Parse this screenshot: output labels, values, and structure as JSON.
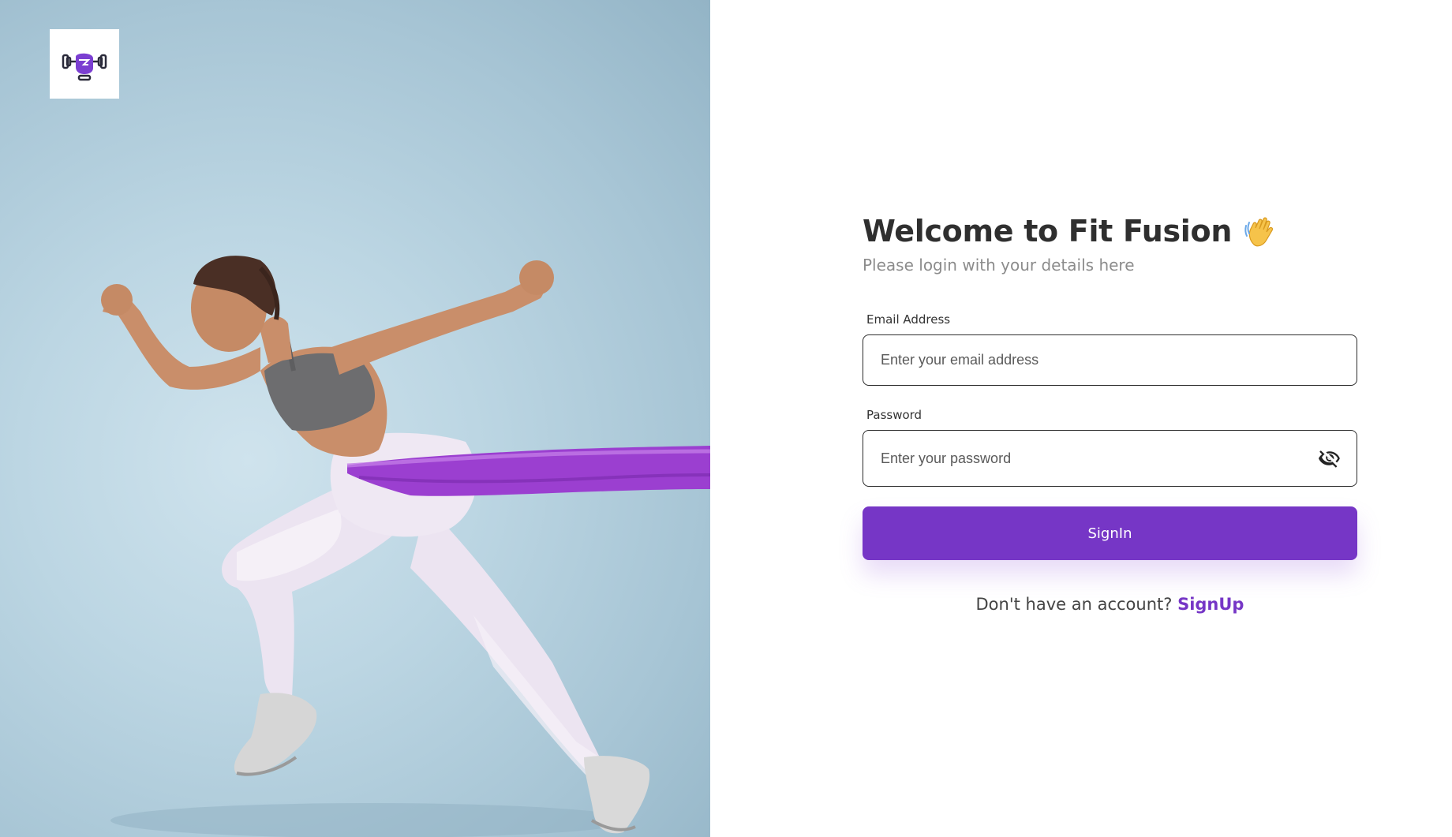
{
  "app": {
    "name": "Fit Fusion"
  },
  "hero": {
    "logo_icon": "dumbbell-boxing-glove-icon",
    "image_subject": "athlete-running-with-resistance-band",
    "band_color": "#9b3fd0"
  },
  "login": {
    "title": "Welcome to Fit Fusion",
    "title_emoji_icon": "waving-hand-icon",
    "subtitle": "Please login with your details here",
    "email": {
      "label": "Email Address",
      "placeholder": "Enter your email address",
      "value": ""
    },
    "password": {
      "label": "Password",
      "placeholder": "Enter your password",
      "value": "",
      "toggle_icon": "eye-off-icon"
    },
    "submit_label": "SignIn",
    "signup_prompt": "Don't have an account?",
    "signup_link": "SignUp"
  },
  "colors": {
    "accent": "#7636c6",
    "title": "#2f2f2f",
    "subtitle": "#8c8c8c",
    "input_border": "#2c2c2c",
    "hero_background": "#bcd6e3"
  }
}
